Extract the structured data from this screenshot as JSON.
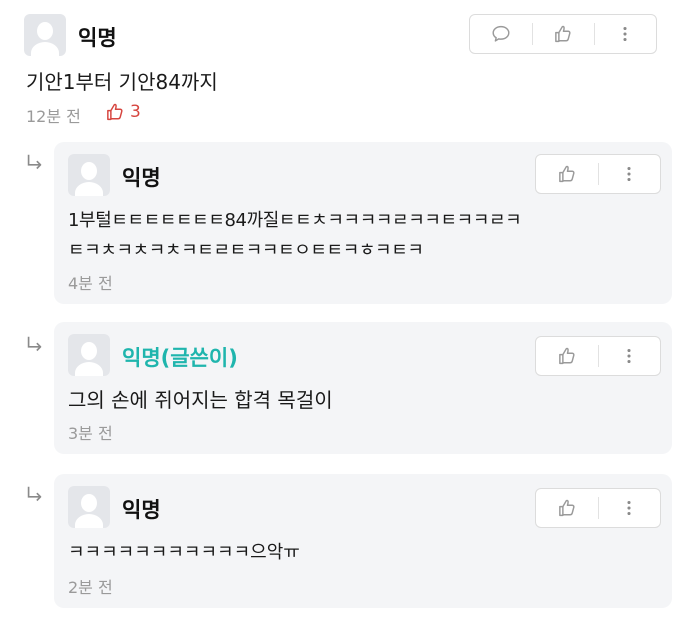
{
  "comments": [
    {
      "author": "익명",
      "text": "기안1부터 기안84까지",
      "time": "12분 전",
      "likes": "3"
    }
  ],
  "replies": [
    {
      "author": "익명",
      "text_lines": [
        "1부털ㅌㅌㅌㅌㅌㅌㅌ84까질ㅌㅌㅊㅋㅋㅋㅋㄹㅋㅋㅌㅋㅋㄹㅋ",
        "ㅌㅋㅊㅋㅊㅋㅊㅋㅌㄹㅌㅋㅋㅌㅇㅌㅌㅋㅎㅋㅌㅋ"
      ],
      "time": "4분 전"
    },
    {
      "author": "익명(글쓴이)",
      "text_lines": [
        "그의 손에 쥐어지는 합격 목걸이"
      ],
      "time": "3분 전"
    },
    {
      "author": "익명",
      "text_lines": [
        "ㅋㅋㅋㅋㅋㅋㅋㅋㅋㅋㅋ으악ㅠ"
      ],
      "time": "2분 전"
    }
  ],
  "icons": {
    "reply": "speech-bubble-icon",
    "like": "thumbs-up-icon",
    "more": "more-vertical-icon",
    "reply_indent": "reply-arrow-icon"
  },
  "colors": {
    "op_name": "#1fb5ad",
    "like_count": "#d6453f",
    "reply_bg": "#f4f5f7"
  }
}
